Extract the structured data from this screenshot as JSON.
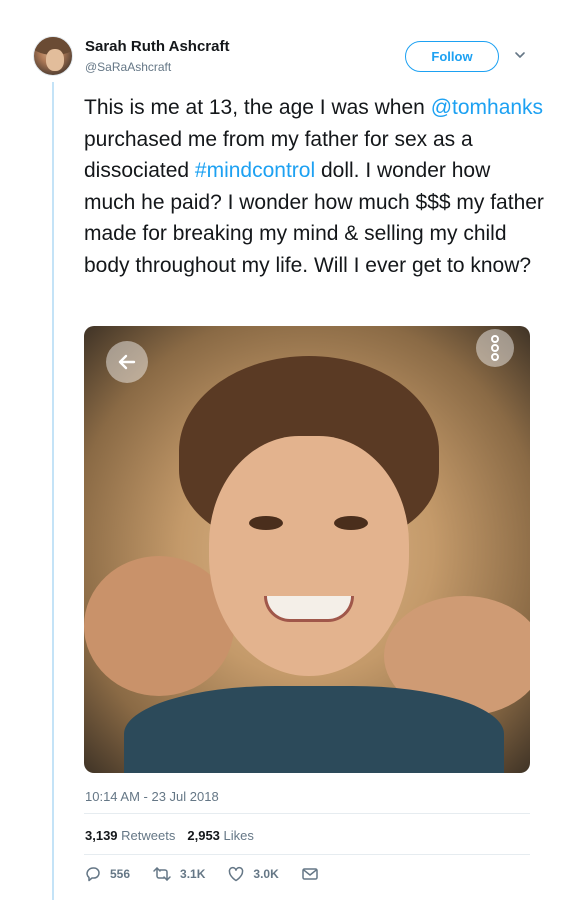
{
  "user": {
    "name": "Sarah Ruth Ashcraft",
    "handle": "@SaRaAshcraft"
  },
  "follow_label": "Follow",
  "tweet": {
    "segments": [
      {
        "text": "This is me at 13, the age I was when ",
        "type": "text"
      },
      {
        "text": "@tomhanks",
        "type": "mention"
      },
      {
        "text": " purchased me from my father for sex as a dissociated ",
        "type": "text"
      },
      {
        "text": "#mindcontrol",
        "type": "hashtag"
      },
      {
        "text": " doll. I wonder how much he paid? I wonder how much $$$ my father made for breaking my mind & selling my child body throughout my life. Will I ever get to know?",
        "type": "text"
      }
    ]
  },
  "media": {
    "back_icon": "arrow-left-icon",
    "more_icon": "more-vertical-icon"
  },
  "timestamp": "10:14 AM - 23 Jul 2018",
  "stats": {
    "retweets_count": "3,139",
    "retweets_label": "Retweets",
    "likes_count": "2,953",
    "likes_label": "Likes"
  },
  "actions": {
    "reply_count": "556",
    "retweet_count": "3.1K",
    "like_count": "3.0K"
  },
  "colors": {
    "accent": "#1da1f2",
    "secondary_text": "#657786",
    "thread_line": "#c4e3f7"
  }
}
